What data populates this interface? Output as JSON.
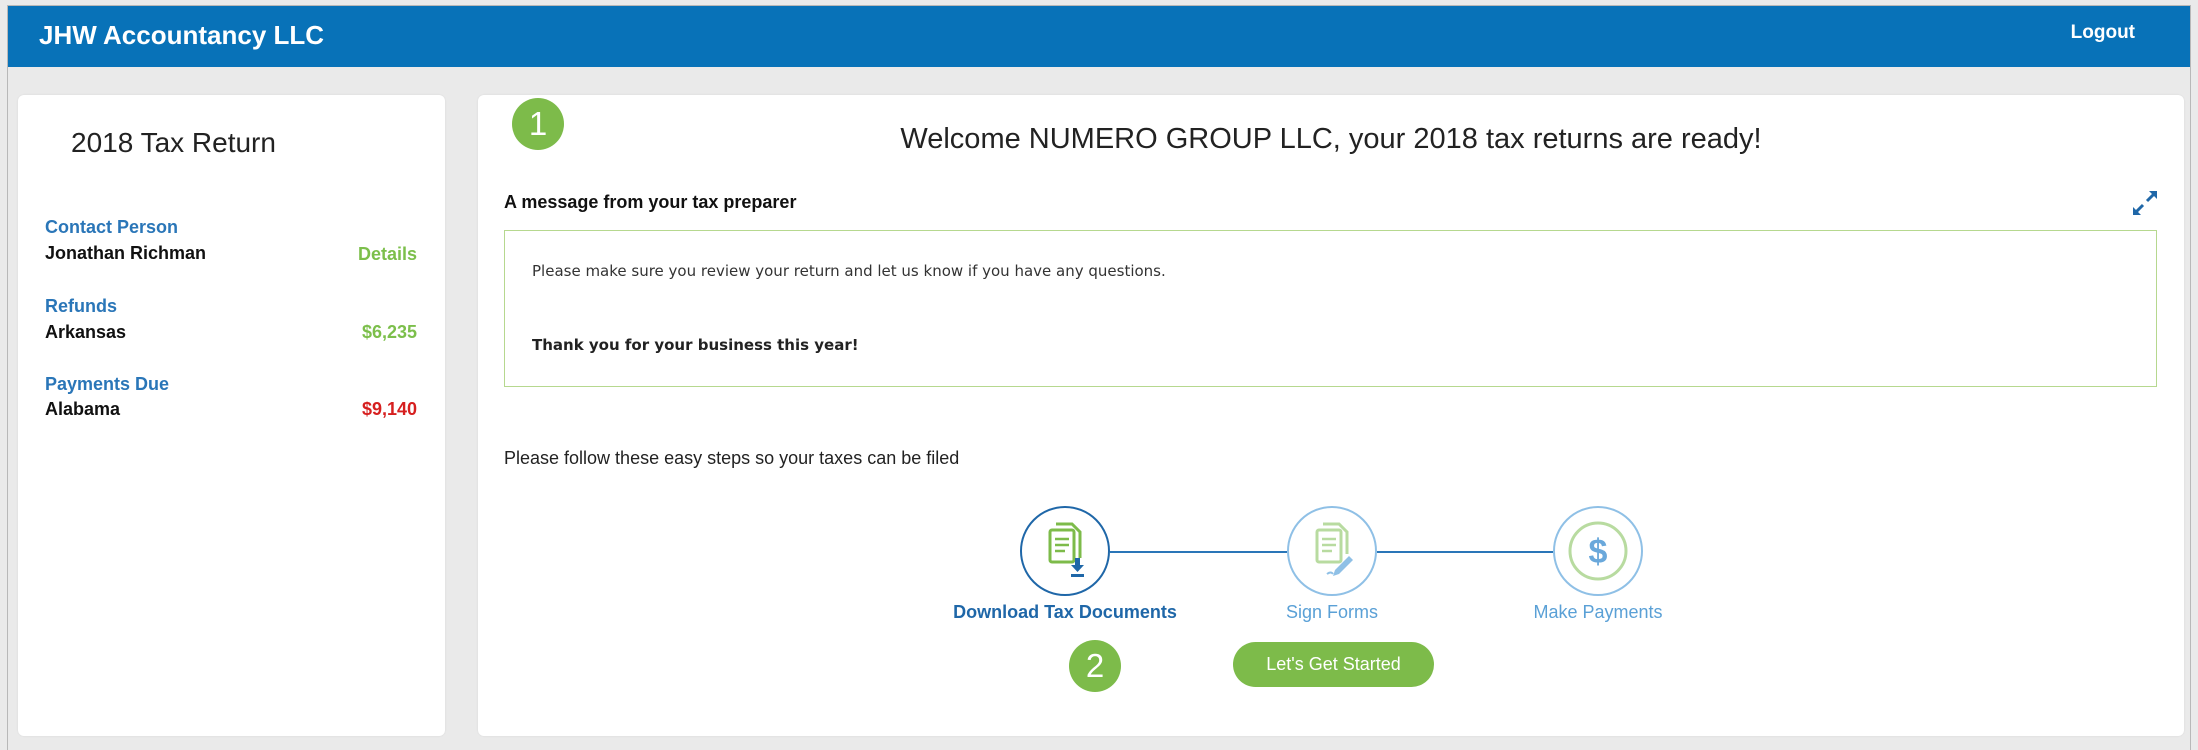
{
  "header": {
    "brand": "JHW Accountancy LLC",
    "logout_label": "Logout",
    "color": "#0872b8"
  },
  "summary": {
    "title": "2018 Tax Return",
    "contact": {
      "label": "Contact Person",
      "name": "Jonathan Richman",
      "action": "Details"
    },
    "refunds": {
      "label": "Refunds",
      "state": "Arkansas",
      "amount": "$6,235"
    },
    "payments_due": {
      "label": "Payments Due",
      "state": "Alabama",
      "amount": "$9,140"
    }
  },
  "main": {
    "badge1": "1",
    "badge2": "2",
    "welcome": "Welcome NUMERO GROUP LLC, your 2018 tax returns are ready!",
    "message_heading": "A message from your tax preparer",
    "message_line1": "Please make sure you review your return and let us know if you have any questions.",
    "message_line2": "Thank you for your business this year!",
    "steps_intro": "Please follow these easy steps so your taxes can be filed",
    "steps": [
      {
        "label": "Download Tax Documents",
        "icon": "download-documents-icon",
        "active": true
      },
      {
        "label": "Sign Forms",
        "icon": "sign-forms-icon",
        "active": false
      },
      {
        "label": "Make Payments",
        "icon": "dollar-icon",
        "active": false
      }
    ],
    "start_button": "Let's Get Started",
    "accent_green": "#7dbb4a",
    "accent_blue": "#1f67a8"
  }
}
